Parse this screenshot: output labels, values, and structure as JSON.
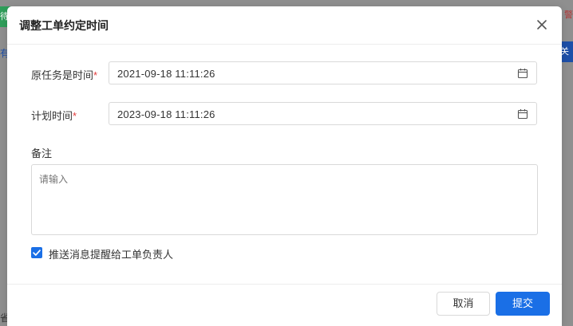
{
  "background": {
    "left_green_tab": "待",
    "right_red_text": "警",
    "left_blue_text": "有",
    "right_blue_tab": "关",
    "bottom_text": "省"
  },
  "dialog": {
    "title": "调整工单约定时间",
    "fields": {
      "original_time": {
        "label": "原任务是时间",
        "required_mark": "*",
        "value": "2021-09-18  11:11:26"
      },
      "plan_time": {
        "label": "计划时间",
        "required_mark": "*",
        "value": "2023-09-18  11:11:26"
      },
      "remark": {
        "label": "备注",
        "placeholder": "请输入",
        "value": ""
      }
    },
    "notify_checkbox": {
      "checked": true,
      "label": "推送消息提醒给工单负责人"
    },
    "buttons": {
      "cancel": "取消",
      "submit": "提交"
    }
  },
  "colors": {
    "primary": "#1a6fe6",
    "required": "#e23b3b",
    "overlay": "#8f8f8f"
  },
  "icons": [
    "close-icon",
    "calendar-icon",
    "check-icon"
  ]
}
